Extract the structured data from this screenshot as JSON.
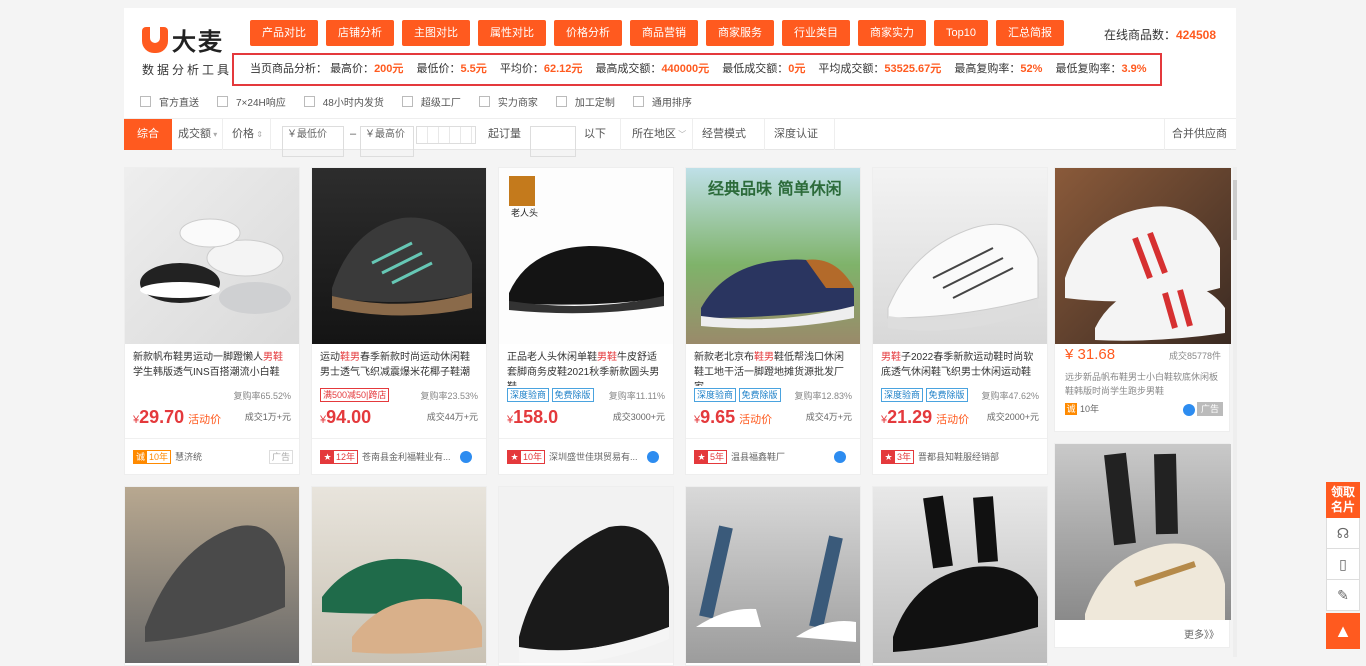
{
  "logo": {
    "name": "大麦",
    "subtitle": "数据分析工具"
  },
  "nav": [
    "产品对比",
    "店铺分析",
    "主图对比",
    "属性对比",
    "价格分析",
    "商品营销",
    "商家服务",
    "行业类目",
    "商家实力",
    "Top10",
    "汇总简报"
  ],
  "online": {
    "label": "在线商品数：",
    "value": "424508"
  },
  "stats": {
    "prefix": "当页商品分析：",
    "items": [
      {
        "label": "最高价：",
        "value": "200元"
      },
      {
        "label": "最低价：",
        "value": "5.5元"
      },
      {
        "label": "平均价：",
        "value": "62.12元"
      },
      {
        "label": "最高成交额：",
        "value": "440000元"
      },
      {
        "label": "最低成交额：",
        "value": "0元"
      },
      {
        "label": "平均成交额：",
        "value": "53525.67元"
      },
      {
        "label": "最高复购率：",
        "value": "52%"
      },
      {
        "label": "最低复购率：",
        "value": "3.9%"
      }
    ]
  },
  "filters": [
    "官方直送",
    "7×24H响应",
    "48小时内发货",
    "超级工厂",
    "实力商家",
    "加工定制",
    "通用排序"
  ],
  "sortbar": {
    "all": "综合",
    "sales": "成交额",
    "price": "价格",
    "min_price": "￥最低价",
    "dash": "–",
    "max_price": "￥最高价",
    "moq": "起订量",
    "moq_unit": "以下",
    "region": "所在地区",
    "mode": "经营模式",
    "depth": "深度认证",
    "merge": "合并供应商"
  },
  "products": [
    {
      "title_pre": "新款帆布鞋男运动一脚蹬懒人",
      "title_hl": "男鞋",
      "title_post": "学生韩版透气INS百搭潮流小白鞋",
      "tags": [],
      "rebuy": "复购率65.52%",
      "price": "29.70",
      "promo": "活动价",
      "sales": "成交1万+元",
      "years": "10年",
      "shop": "慧济统",
      "ad": "广告"
    },
    {
      "title_pre": "运动",
      "title_hl": "鞋男",
      "title_post": "春季新款时尚运动休闲鞋男士透气飞织减震爆米花椰子鞋潮",
      "tags": [
        "满500减50|跨店"
      ],
      "rebuy": "复购率23.53%",
      "price": "94.00",
      "promo": "",
      "sales": "成交44万+元",
      "years": "12年",
      "shop": "苍南县金利福鞋业有...",
      "ad": ""
    },
    {
      "title_pre": "正品老人头休闲单鞋",
      "title_hl": "男鞋",
      "title_post": "牛皮舒适套脚商务皮鞋2021秋季新款圆头男鞋",
      "tags": [
        "深度验商",
        "免费除版"
      ],
      "rebuy": "复购率11.11%",
      "price": "158.0",
      "promo": "",
      "sales": "成交3000+元",
      "years": "10年",
      "shop": "深圳盛世佳琪贸易有...",
      "ad": ""
    },
    {
      "title_pre": "新款老北京布",
      "title_hl": "鞋男",
      "title_post": "鞋低帮浅口休闲鞋工地干活一脚蹬地摊货源批发厂家",
      "tags": [
        "深度验商",
        "免费除版"
      ],
      "rebuy": "复购率12.83%",
      "price": "9.65",
      "promo": "活动价",
      "sales": "成交4万+元",
      "years": "5年",
      "shop": "温县福鑫鞋厂",
      "ad": ""
    },
    {
      "title_pre": "",
      "title_hl": "男鞋",
      "title_post": "子2022春季新款运动鞋时尚软底透气休闲鞋飞织男士休闲运动鞋",
      "tags": [
        "深度验商",
        "免费除版"
      ],
      "rebuy": "复购率47.62%",
      "price": "21.29",
      "promo": "活动价",
      "sales": "成交2000+元",
      "years": "3年",
      "shop": "晋都县知鞋服经销部",
      "ad": ""
    }
  ],
  "side_product": {
    "price": "31.68",
    "sales": "成交85778件",
    "title": "远步新品帆布鞋男士小白鞋软底休闲板鞋韩版时尚学生跑步男鞋",
    "years": "10年",
    "ad": "广告",
    "more": "更多》》"
  },
  "rightbar": {
    "card": "领取名片",
    "top": "▲"
  }
}
